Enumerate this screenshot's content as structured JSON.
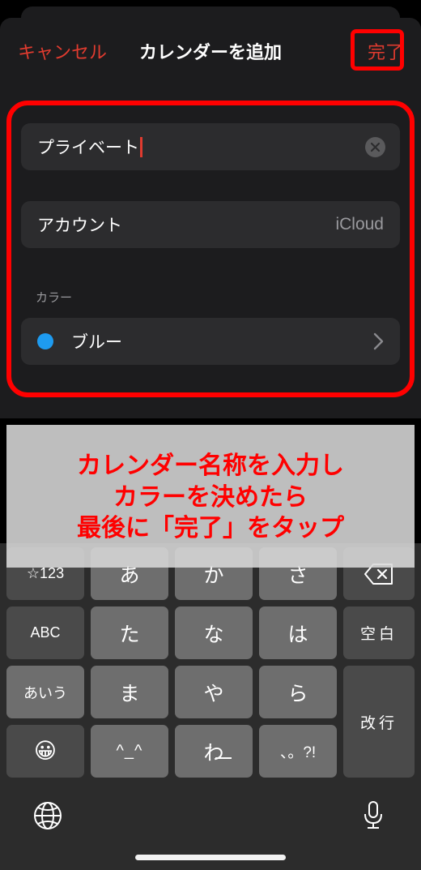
{
  "navbar": {
    "cancel_label": "キャンセル",
    "title": "カレンダーを追加",
    "done_label": "完了",
    "cancel_color": "#e03b2f",
    "done_color": "#e03b2f",
    "highlight_color": "#ff0000"
  },
  "form": {
    "name_field": {
      "value": "プライベート",
      "clear_icon": "clear-circle-icon",
      "caret_color": "#e03b2f"
    },
    "account_row": {
      "label": "アカウント",
      "value": "iCloud"
    },
    "color_section": {
      "header": "カラー",
      "selected_name": "ブルー",
      "selected_hex": "#1e9bf0",
      "chevron_icon": "chevron-right-icon"
    }
  },
  "annotation": {
    "lines": [
      "カレンダー名称を入力し",
      "カラーを決めたら",
      "最後に「完了」をタップ"
    ],
    "text_color": "#ff0000",
    "background": "#d8d8d8"
  },
  "keyboard": {
    "rows": [
      [
        {
          "label": "☆123",
          "type": "fn",
          "name": "key-numbers-symbols"
        },
        {
          "label": "あ",
          "type": "char",
          "name": "key-a-row"
        },
        {
          "label": "か",
          "type": "char",
          "name": "key-ka-row"
        },
        {
          "label": "さ",
          "type": "char",
          "name": "key-sa-row"
        },
        {
          "label": "",
          "type": "fn",
          "name": "key-backspace",
          "icon": "backspace-icon"
        }
      ],
      [
        {
          "label": "ABC",
          "type": "fn",
          "name": "key-abc"
        },
        {
          "label": "た",
          "type": "char",
          "name": "key-ta-row"
        },
        {
          "label": "な",
          "type": "char",
          "name": "key-na-row"
        },
        {
          "label": "は",
          "type": "char",
          "name": "key-ha-row"
        },
        {
          "label": "空白",
          "type": "fn",
          "name": "key-space"
        }
      ],
      [
        {
          "label": "あいう",
          "type": "char",
          "name": "key-kana-mode"
        },
        {
          "label": "ま",
          "type": "char",
          "name": "key-ma-row"
        },
        {
          "label": "や",
          "type": "char",
          "name": "key-ya-row"
        },
        {
          "label": "ら",
          "type": "char",
          "name": "key-ra-row"
        },
        {
          "label": "改行",
          "type": "fn",
          "name": "key-return"
        }
      ],
      [
        {
          "label": "😀",
          "type": "fn",
          "name": "key-emoji"
        },
        {
          "label": "^_^",
          "type": "char",
          "name": "key-kaomoji"
        },
        {
          "label": "わ",
          "type": "char",
          "name": "key-wa-row"
        },
        {
          "label": "、。?!",
          "type": "char",
          "name": "key-punctuation"
        }
      ]
    ],
    "bottom": {
      "globe_icon": "globe-icon",
      "mic_icon": "microphone-icon"
    }
  }
}
